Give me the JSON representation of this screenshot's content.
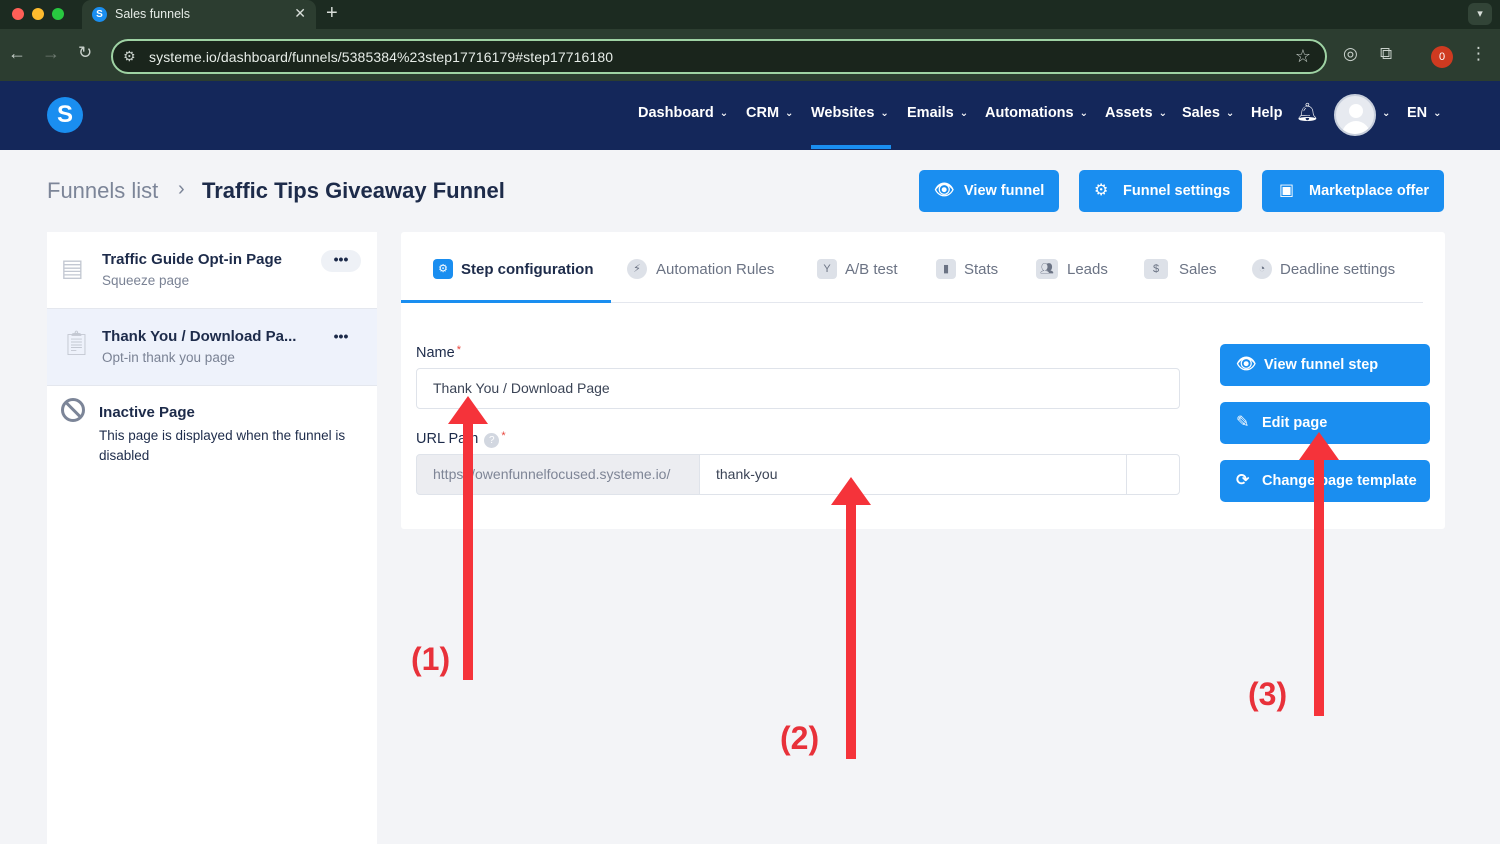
{
  "browser": {
    "tab_title": "Sales funnels",
    "tab_close": "✕",
    "new_tab": "+",
    "url": "systeme.io/dashboard/funnels/5385384%23step17716179#step17716180",
    "extension_badge": "0"
  },
  "app": {
    "logo_letter": "S",
    "menu": [
      {
        "label": "Dashboard",
        "has_dropdown": true
      },
      {
        "label": "CRM",
        "has_dropdown": true
      },
      {
        "label": "Websites",
        "has_dropdown": true,
        "active": true
      },
      {
        "label": "Emails",
        "has_dropdown": true
      },
      {
        "label": "Automations",
        "has_dropdown": true
      },
      {
        "label": "Assets",
        "has_dropdown": true
      },
      {
        "label": "Sales",
        "has_dropdown": true
      },
      {
        "label": "Help",
        "has_dropdown": false
      }
    ],
    "language": "EN",
    "accent_color": "#1a8ef0",
    "header_color": "#14275a"
  },
  "page": {
    "breadcrumb_root": "Funnels list",
    "breadcrumb_sep": "›",
    "title": "Traffic Tips Giveaway Funnel",
    "actions": {
      "view_funnel": "View funnel",
      "funnel_settings": "Funnel settings",
      "marketplace_offer": "Marketplace offer"
    }
  },
  "sidebar": {
    "items": [
      {
        "title": "Traffic Guide Opt-in Page",
        "subtitle": "Squeeze page",
        "menu": "•••"
      },
      {
        "title": "Thank You / Download Pa...",
        "subtitle": "Opt-in thank you page",
        "menu": "•••",
        "active": true
      },
      {
        "title": "Inactive Page",
        "subtitle": "This page is displayed when the funnel is disabled"
      }
    ]
  },
  "step": {
    "tabs": [
      {
        "label": "Step configuration",
        "icon": "sliders-icon",
        "active": true
      },
      {
        "label": "Automation Rules",
        "icon": "bolt-icon"
      },
      {
        "label": "A/B test",
        "icon": "split-icon"
      },
      {
        "label": "Stats",
        "icon": "bar-chart-icon"
      },
      {
        "label": "Leads",
        "icon": "users-icon"
      },
      {
        "label": "Sales",
        "icon": "dollar-icon"
      },
      {
        "label": "Deadline settings",
        "icon": "clock-icon"
      }
    ],
    "name_label": "Name",
    "name_value": "Thank You / Download Page",
    "url_label": "URL Path",
    "url_prefix": "https://owenfunnelfocused.systeme.io/",
    "url_value": "thank-you",
    "required_mark": "*",
    "help_mark": "?",
    "buttons": {
      "view_step": "View funnel step",
      "edit_page": "Edit page",
      "change_template": "Change page template"
    }
  },
  "annotations": {
    "label_1": "(1)",
    "label_2": "(2)",
    "label_3": "(3)",
    "color": "#f5333a"
  }
}
